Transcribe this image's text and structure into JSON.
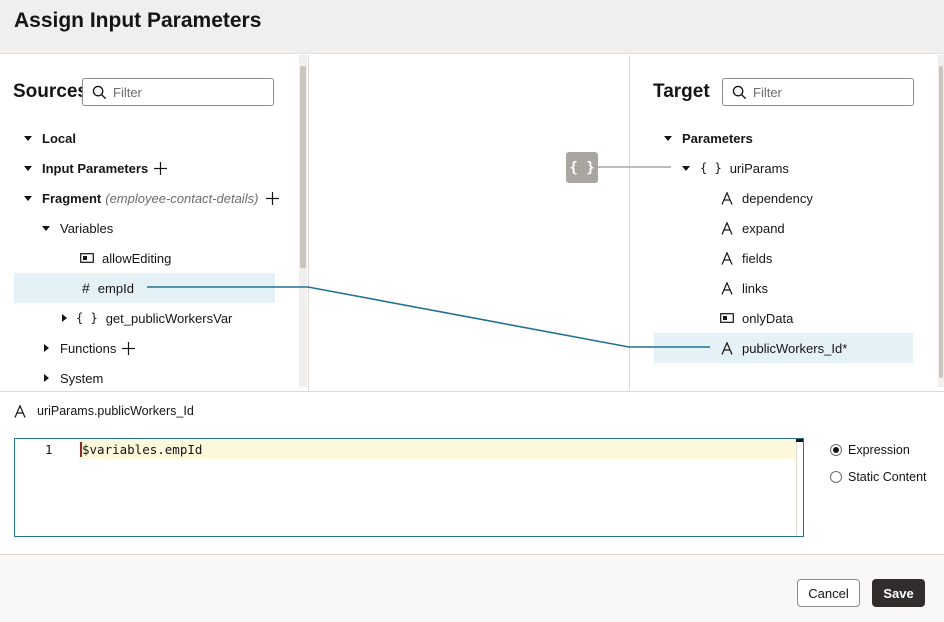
{
  "dialog": {
    "title": "Assign Input Parameters"
  },
  "sources": {
    "title": "Sources",
    "filter_placeholder": "Filter",
    "items": [
      {
        "label": "Local"
      },
      {
        "label": "Input Parameters"
      },
      {
        "label": "Fragment",
        "note": "(employee-contact-details)"
      },
      {
        "label": "Variables"
      },
      {
        "label": "allowEditing"
      },
      {
        "label": "empId"
      },
      {
        "label": "get_publicWorkersVar"
      },
      {
        "label": "Functions"
      },
      {
        "label": "System"
      }
    ]
  },
  "target": {
    "title": "Target",
    "filter_placeholder": "Filter",
    "object_badge": "{ }",
    "items": [
      {
        "label": "Parameters"
      },
      {
        "label": "uriParams"
      },
      {
        "label": "dependency"
      },
      {
        "label": "expand"
      },
      {
        "label": "fields"
      },
      {
        "label": "links"
      },
      {
        "label": "onlyData"
      },
      {
        "label": "publicWorkers_Id*"
      }
    ]
  },
  "editor": {
    "path": "uriParams.publicWorkers_Id",
    "line_number": "1",
    "code": "$variables.empId"
  },
  "mode": {
    "options": [
      {
        "label": "Expression",
        "checked": true
      },
      {
        "label": "Static Content",
        "checked": false
      }
    ]
  },
  "footer": {
    "cancel_label": "Cancel",
    "save_label": "Save"
  },
  "colors": {
    "mapping_line": "#227290",
    "selected_row": "#e4f1f7",
    "primary_button": "#312d2a"
  }
}
